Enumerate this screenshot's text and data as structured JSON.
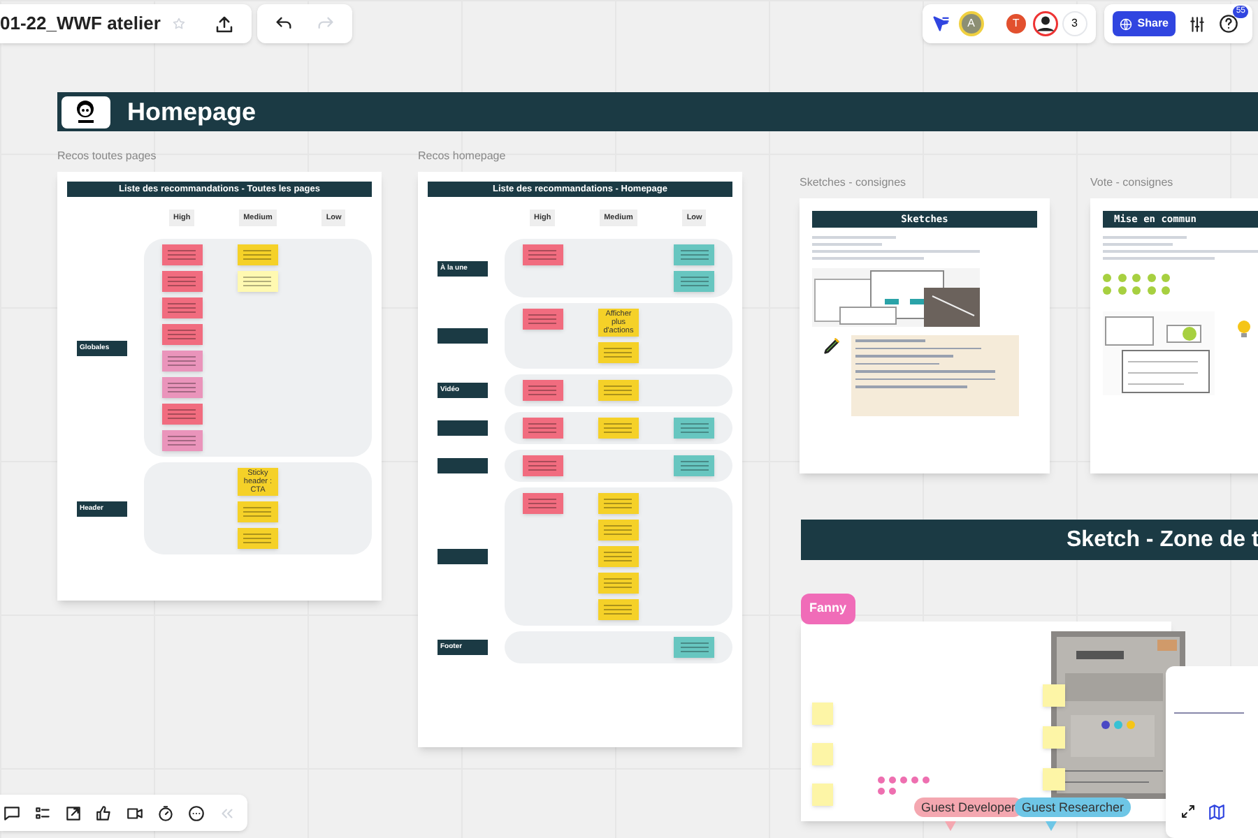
{
  "board": {
    "title": "01-22_WWF atelier"
  },
  "topbar": {
    "avatars": [
      {
        "initial": "A",
        "color": "#8c8f74"
      },
      {
        "initial": "T",
        "color": "#e2502e"
      }
    ],
    "count": "3",
    "share": "Share",
    "help_badge": "55"
  },
  "banner": {
    "title": "Homepage"
  },
  "frames": [
    {
      "label": "Recos toutes pages",
      "title": "Liste des recommandations - Toutes les pages",
      "columns": [
        "High",
        "Medium",
        "Low"
      ],
      "sections": [
        {
          "label": "Globales",
          "high": [
            {
              "color": "#f16c7f"
            },
            {
              "color": "#f16c7f"
            },
            {
              "color": "#f16c7f"
            },
            {
              "color": "#f16c7f"
            },
            {
              "color": "#ea94bb"
            },
            {
              "color": "#ea94bb"
            },
            {
              "color": "#f16c7f"
            },
            {
              "color": "#ea94bb"
            }
          ],
          "medium": [
            {
              "color": "#f5d128"
            },
            {
              "color": "#fff9b1"
            }
          ]
        },
        {
          "label": "Header",
          "medium": [
            {
              "color": "#f5d128",
              "text": "Sticky header : CTA"
            },
            {
              "color": "#f5d128"
            },
            {
              "color": "#f5d128"
            }
          ]
        }
      ]
    },
    {
      "label": "Recos homepage",
      "title": "Liste des recommandations - Homepage",
      "columns": [
        "High",
        "Medium",
        "Low"
      ],
      "sections": [
        {
          "label": "À la une",
          "high": [
            {
              "color": "#f16c7f"
            }
          ],
          "low": [
            {
              "color": "#67c6c0"
            },
            {
              "color": "#67c6c0"
            }
          ]
        },
        {
          "high": [
            {
              "color": "#f16c7f"
            }
          ],
          "medium": [
            {
              "color": "#f5d128",
              "text": "Afficher plus d'actions"
            },
            {
              "color": "#f5d128"
            }
          ]
        },
        {
          "label": "Vidéo",
          "high": [
            {
              "color": "#f16c7f"
            }
          ],
          "medium": [
            {
              "color": "#f5d128"
            }
          ]
        },
        {
          "high": [
            {
              "color": "#f16c7f"
            }
          ],
          "medium": [
            {
              "color": "#f5d128"
            }
          ],
          "low": [
            {
              "color": "#67c6c0"
            }
          ]
        },
        {
          "high": [
            {
              "color": "#f16c7f"
            }
          ],
          "low": [
            {
              "color": "#67c6c0"
            }
          ]
        },
        {
          "high": [
            {
              "color": "#f16c7f"
            }
          ],
          "medium": [
            {
              "color": "#f5d128"
            },
            {
              "color": "#f5d128"
            },
            {
              "color": "#f5d128"
            },
            {
              "color": "#f5d128"
            },
            {
              "color": "#f5d128"
            }
          ]
        },
        {
          "label": "Footer",
          "low": [
            {
              "color": "#67c6c0"
            }
          ]
        }
      ]
    }
  ],
  "instructions": [
    {
      "label": "Sketches - consignes",
      "title": "Sketches"
    },
    {
      "label": "Vote - consignes",
      "title": "Mise en commun"
    }
  ],
  "zone_banner": {
    "title": "Sketch - Zone de t"
  },
  "fanny_tag": "Fanny",
  "cursors": [
    {
      "name": "Guest Developer",
      "color": "#f4a7b0"
    },
    {
      "name": "Guest Researcher",
      "color": "#6ec6e6"
    }
  ]
}
